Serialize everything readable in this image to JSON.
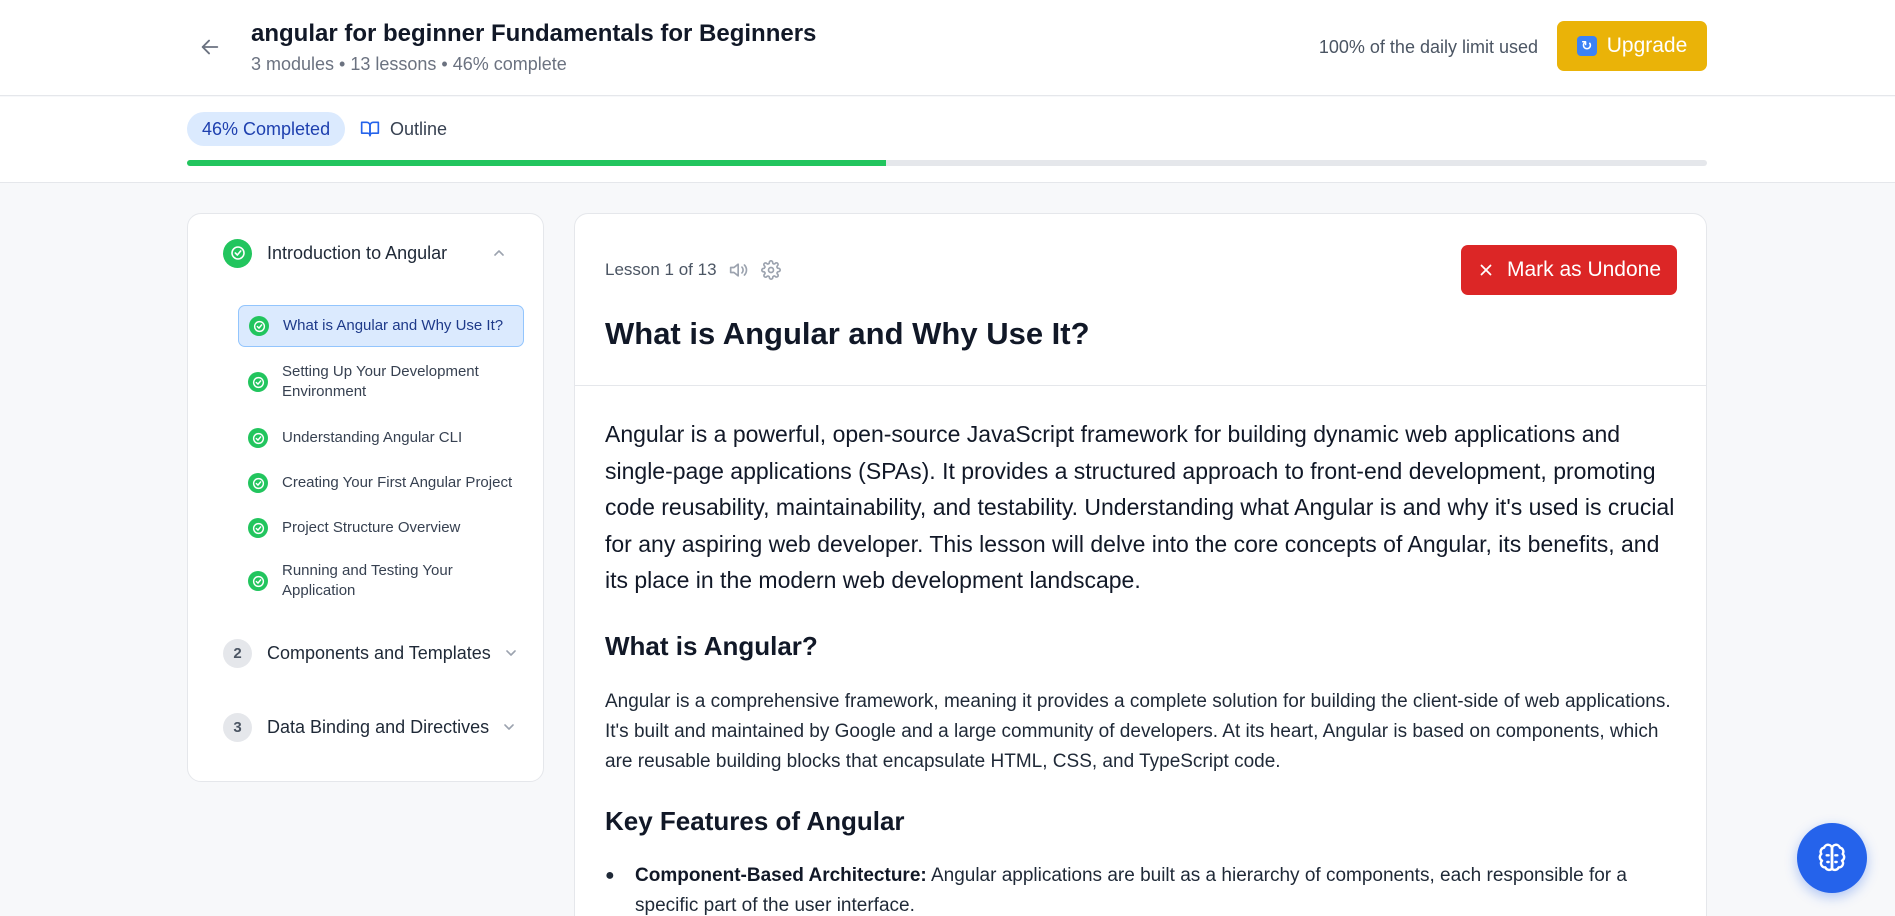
{
  "header": {
    "course_title": "angular for beginner Fundamentals for Beginners",
    "course_meta": "3 modules • 13 lessons • 46% complete",
    "limit_text": "100% of the daily limit used",
    "upgrade_label": "Upgrade"
  },
  "progress": {
    "pill_label": "46% Completed",
    "outline_label": "Outline",
    "fraction": 0.46,
    "fill_color": "#22c55e"
  },
  "sidebar": {
    "modules": [
      {
        "number": "1",
        "title": "Introduction to Angular",
        "completed": true,
        "expanded": true
      },
      {
        "number": "2",
        "title": "Components and Templates",
        "completed": false,
        "expanded": false
      },
      {
        "number": "3",
        "title": "Data Binding and Directives",
        "completed": false,
        "expanded": false
      }
    ],
    "lessons": [
      {
        "title": "What is Angular and Why Use It?",
        "active": true
      },
      {
        "title": "Setting Up Your Development Environment",
        "active": false
      },
      {
        "title": "Understanding Angular CLI",
        "active": false
      },
      {
        "title": "Creating Your First Angular Project",
        "active": false
      },
      {
        "title": "Project Structure Overview",
        "active": false
      },
      {
        "title": "Running and Testing Your Application",
        "active": false
      }
    ]
  },
  "lesson": {
    "counter": "Lesson 1 of 13",
    "mark_undone_label": "Mark as Undone",
    "title": "What is Angular and Why Use It?",
    "intro": "Angular is a powerful, open-source JavaScript framework for building dynamic web applications and single-page applications (SPAs). It provides a structured approach to front-end development, promoting code reusability, maintainability, and testability. Understanding what Angular is and why it's used is crucial for any aspiring web developer. This lesson will delve into the core concepts of Angular, its benefits, and its place in the modern web development landscape.",
    "section1_heading": "What is Angular?",
    "section1_body": "Angular is a comprehensive framework, meaning it provides a complete solution for building the client-side of web applications. It's built and maintained by Google and a large community of developers. At its heart, Angular is based on components, which are reusable building blocks that encapsulate HTML, CSS, and TypeScript code.",
    "section2_heading": "Key Features of Angular",
    "features": [
      {
        "term": "Component-Based Architecture:",
        "text": " Angular applications are built as a hierarchy of components, each responsible for a specific part of the user interface."
      }
    ]
  },
  "colors": {
    "accent_blue": "#2563eb",
    "success_green": "#22c55e",
    "upgrade_yellow": "#eab308",
    "danger_red": "#dc2626"
  },
  "icons": {
    "back": "arrow-left-icon",
    "upgrade": "refresh-icon",
    "outline": "book-open-icon",
    "audio": "speaker-icon",
    "settings": "gear-icon",
    "undone": "close-icon",
    "module_done": "check-circle-icon",
    "chevron_up": "chevron-up-icon",
    "chevron_down": "chevron-down-icon",
    "assistant": "brain-icon"
  }
}
